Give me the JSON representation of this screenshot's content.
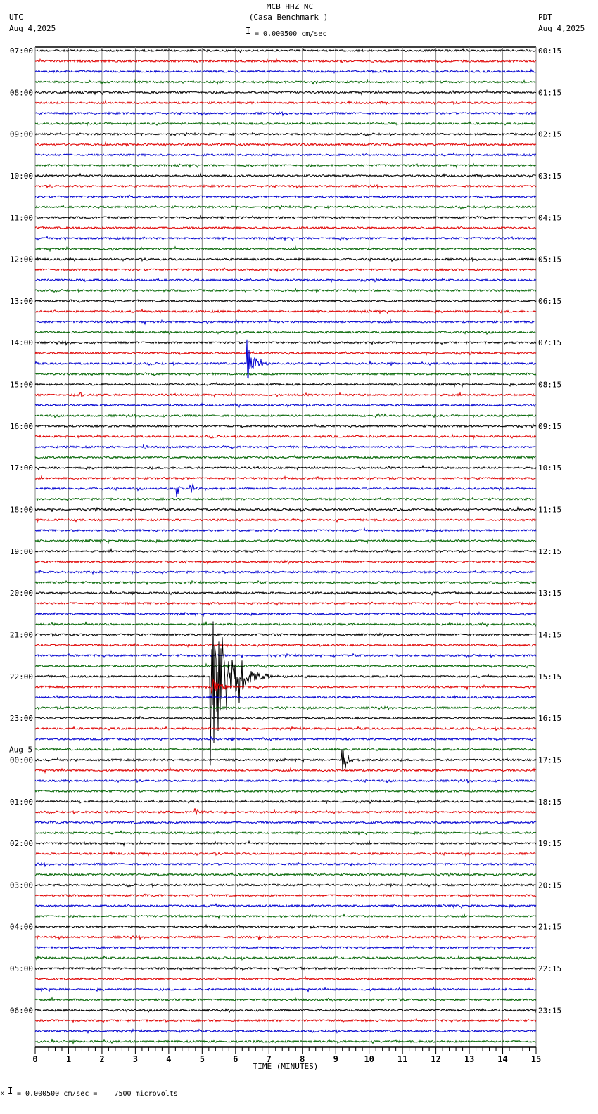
{
  "header": {
    "station": "MCB HHZ NC",
    "site": "(Casa Benchmark )",
    "scale": "= 0.000500 cm/sec",
    "left_tz": "UTC",
    "left_date": "Aug 4,2025",
    "right_tz": "PDT",
    "right_date": "Aug 4,2025"
  },
  "footer": {
    "scale_note": "= 0.000500 cm/sec =    7500 microvolts",
    "prefix": "x"
  },
  "chart_data": {
    "type": "line",
    "title": "MCB HHZ NC (Casa Benchmark )",
    "xlabel": "TIME (MINUTES)",
    "xlim": [
      0,
      15
    ],
    "x_ticks": [
      "0",
      "1",
      "2",
      "3",
      "4",
      "5",
      "6",
      "7",
      "8",
      "9",
      "10",
      "11",
      "12",
      "13",
      "14",
      "15"
    ],
    "minutes_per_line": 15,
    "line_count": 96,
    "trace_colors": [
      "#000000",
      "#e00000",
      "#0000d0",
      "#006400"
    ],
    "grid": true,
    "left_labels": [
      "07:00",
      "08:00",
      "09:00",
      "10:00",
      "11:00",
      "12:00",
      "13:00",
      "14:00",
      "15:00",
      "16:00",
      "17:00",
      "18:00",
      "19:00",
      "20:00",
      "21:00",
      "22:00",
      "23:00",
      "00:00",
      "01:00",
      "02:00",
      "03:00",
      "04:00",
      "05:00",
      "06:00"
    ],
    "date_change_label": "Aug 5",
    "date_change_index": 17,
    "right_labels": [
      "00:15",
      "01:15",
      "02:15",
      "03:15",
      "04:15",
      "05:15",
      "06:15",
      "07:15",
      "08:15",
      "09:15",
      "10:15",
      "11:15",
      "12:15",
      "13:15",
      "14:15",
      "15:15",
      "16:15",
      "17:15",
      "18:15",
      "19:15",
      "20:15",
      "21:15",
      "22:15",
      "23:15"
    ],
    "events": [
      {
        "line": 30,
        "minute": 6.35,
        "amplitude": 2.3,
        "duration": 0.4
      },
      {
        "line": 33,
        "minute": 1.35,
        "amplitude": 0.3,
        "duration": 0.1
      },
      {
        "line": 35,
        "minute": 10.2,
        "amplitude": 0.4,
        "duration": 0.15
      },
      {
        "line": 38,
        "minute": 3.25,
        "amplitude": 0.4,
        "duration": 0.1
      },
      {
        "line": 42,
        "minute": 4.25,
        "amplitude": 0.8,
        "duration": 0.2
      },
      {
        "line": 42,
        "minute": 4.65,
        "amplitude": 0.6,
        "duration": 0.3
      },
      {
        "line": 60,
        "minute": 5.25,
        "amplitude": 10.5,
        "duration": 0.9
      },
      {
        "line": 60,
        "minute": 6.1,
        "amplitude": 2.4,
        "duration": 0.4
      },
      {
        "line": 61,
        "minute": 5.3,
        "amplitude": 0.8,
        "duration": 0.5
      },
      {
        "line": 68,
        "minute": 9.2,
        "amplitude": 1.5,
        "duration": 0.3
      },
      {
        "line": 73,
        "minute": 4.8,
        "amplitude": 0.3,
        "duration": 0.3
      },
      {
        "line": 85,
        "minute": 6.7,
        "amplitude": 0.4,
        "duration": 0.1
      }
    ]
  }
}
